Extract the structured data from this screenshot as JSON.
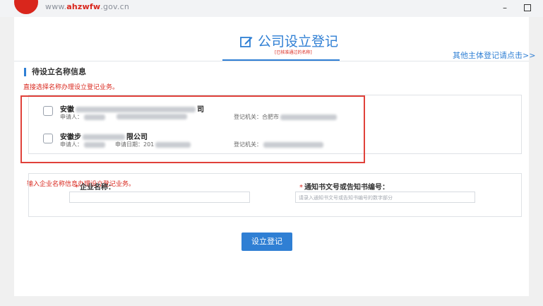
{
  "site": {
    "url_prefix": "www.",
    "url_brand": "ahzwfw",
    "url_suffix": ".gov.cn"
  },
  "window": {
    "minimize": "–"
  },
  "header": {
    "title": "公司设立登记",
    "subtitle": "[已核准通过的名称]",
    "other_link": "其他主体登记请点击>>"
  },
  "pending": {
    "title": "待设立名称信息",
    "tip": "直接选择名称办理设立登记业务。",
    "items": [
      {
        "name_prefix": "安徽",
        "name_suffix": "司",
        "applicant_label": "申请人：",
        "authority_label": "登记机关：",
        "authority_value": "合肥市"
      },
      {
        "name_prefix": "安徽步",
        "name_suffix": "限公司",
        "applicant_label": "申请人：",
        "date_label": "申请日期：",
        "date_value": "201",
        "authority_label": "登记机关："
      }
    ]
  },
  "form": {
    "tip": "输入企业名称信息办理设立登记业务。",
    "company_label": "企业名称：",
    "notice_label": "通知书文号或告知书编号：",
    "notice_placeholder": "请录入通知书文号或告知书编号的数字部分",
    "required_mark": "*"
  },
  "submit_label": "设立登记",
  "colors": {
    "accent": "#2f7fd4",
    "alert": "#d9261c",
    "highlight": "#e0413a"
  }
}
